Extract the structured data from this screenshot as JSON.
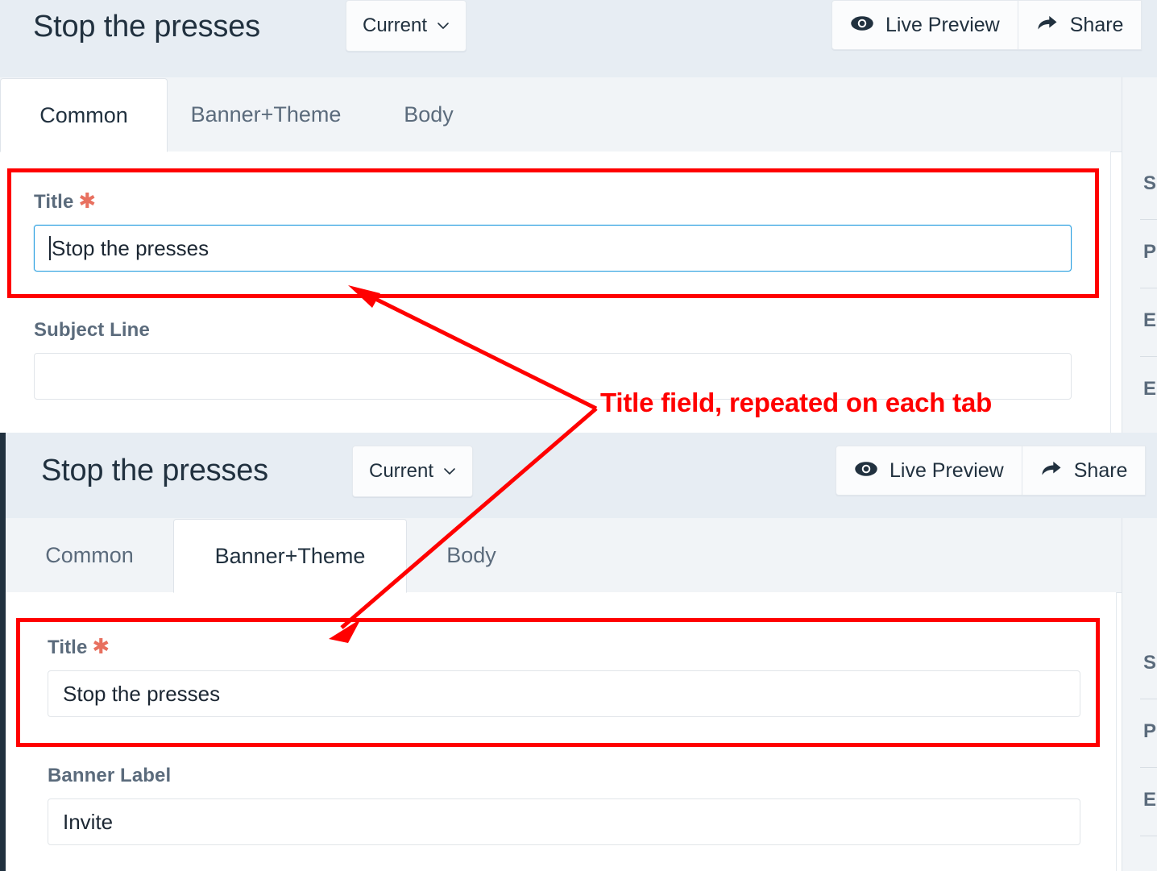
{
  "annotation": {
    "text": "Title field, repeated on each tab",
    "color": "#ff0000"
  },
  "screenshot_top": {
    "header": {
      "title": "Stop the presses",
      "version_selector": {
        "label": "Current",
        "icon": "chevron-down-icon"
      },
      "actions": [
        {
          "label": "Live Preview",
          "icon": "eye-icon"
        },
        {
          "label": "Share",
          "icon": "share-arrow-icon"
        }
      ]
    },
    "tabs": [
      {
        "label": "Common",
        "active": true
      },
      {
        "label": "Banner+Theme",
        "active": false
      },
      {
        "label": "Body",
        "active": false
      }
    ],
    "fields": [
      {
        "label": "Title",
        "required": true,
        "value": "Stop the presses",
        "placeholder": "",
        "focused": true
      },
      {
        "label": "Subject Line",
        "required": false,
        "value": "",
        "placeholder": "",
        "focused": false
      }
    ],
    "rail_items": [
      "S",
      "P",
      "E",
      "E"
    ]
  },
  "screenshot_bottom": {
    "header": {
      "title": "Stop the presses",
      "version_selector": {
        "label": "Current",
        "icon": "chevron-down-icon"
      },
      "actions": [
        {
          "label": "Live Preview",
          "icon": "eye-icon"
        },
        {
          "label": "Share",
          "icon": "share-arrow-icon"
        }
      ]
    },
    "tabs": [
      {
        "label": "Common",
        "active": false
      },
      {
        "label": "Banner+Theme",
        "active": true
      },
      {
        "label": "Body",
        "active": false
      }
    ],
    "fields": [
      {
        "label": "Title",
        "required": true,
        "value": "Stop the presses",
        "placeholder": "",
        "focused": false
      },
      {
        "label": "Banner Label",
        "required": false,
        "value": "Invite",
        "placeholder": "",
        "focused": false
      }
    ],
    "rail_items": [
      "S",
      "P",
      "E"
    ]
  }
}
